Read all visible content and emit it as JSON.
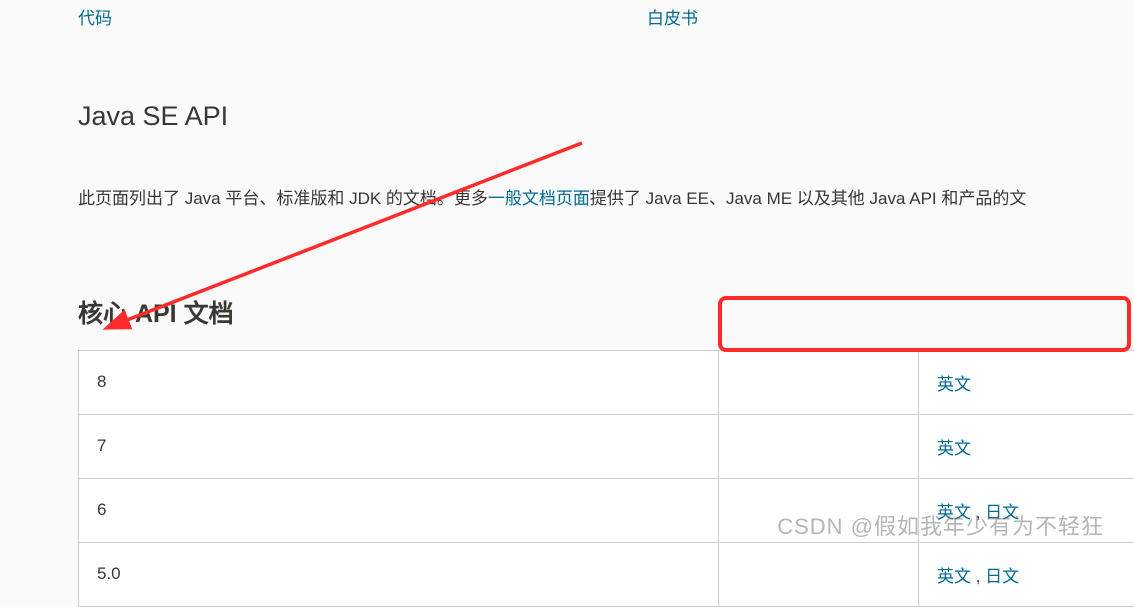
{
  "nav": {
    "left": "代码",
    "right": "白皮书"
  },
  "page_title": "Java SE API",
  "intro": {
    "before": "此页面列出了 Java 平台、标准版和 JDK 的文档。更多",
    "link": "一般文档页面",
    "after": "提供了 Java EE、Java ME 以及其他 Java API 和产品的文"
  },
  "section_title": "核心 API 文档",
  "rows": [
    {
      "version": "8",
      "langs": [
        {
          "label": "英文"
        }
      ]
    },
    {
      "version": "7",
      "langs": [
        {
          "label": "英文"
        }
      ]
    },
    {
      "version": "6",
      "langs": [
        {
          "label": "英文"
        },
        {
          "label": "日文"
        }
      ]
    },
    {
      "version": "5.0",
      "langs": [
        {
          "label": "英文"
        },
        {
          "label": "日文"
        }
      ]
    }
  ],
  "watermark": "CSDN @假如我年少有为不轻狂"
}
